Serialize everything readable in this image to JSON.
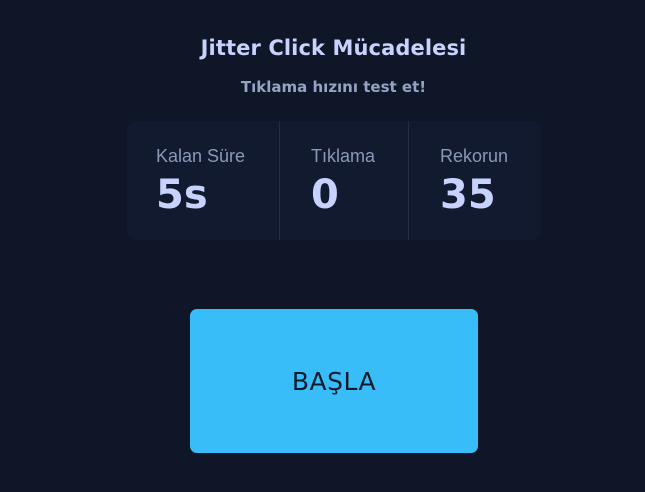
{
  "header": {
    "title": "Jitter Click Mücadelesi",
    "subtitle": "Tıklama hızını test et!"
  },
  "stats": {
    "time_left": {
      "label": "Kalan Süre",
      "value": "5s"
    },
    "clicks": {
      "label": "Tıklama",
      "value": "0"
    },
    "record": {
      "label": "Rekorun",
      "value": "35"
    }
  },
  "start_button": {
    "label": "BAŞLA"
  },
  "colors": {
    "background": "#0f1628",
    "panel": "#111a2e",
    "text_primary": "#c7d2fe",
    "text_secondary": "#8a98b8",
    "accent": "#38bdf8"
  }
}
